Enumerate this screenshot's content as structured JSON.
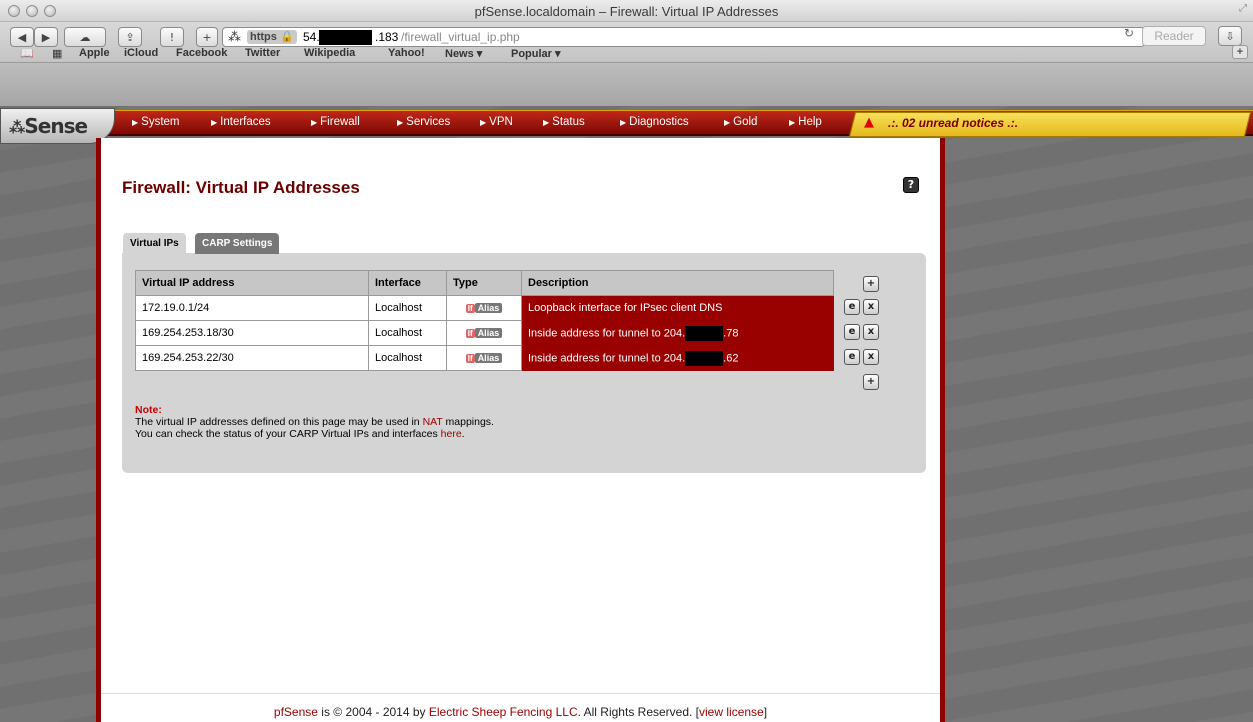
{
  "window": {
    "title": "pfSense.localdomain – Firewall: Virtual IP Addresses"
  },
  "address": {
    "https": "https",
    "host_prefix": "54.",
    "host_suffix": ".183",
    "path": "/firewall_virtual_ip.php",
    "reader": "Reader"
  },
  "bookmarks": [
    "Apple",
    "iCloud",
    "Facebook",
    "Twitter",
    "Wikipedia",
    "Yahoo!",
    "News ▾",
    "Popular ▾"
  ],
  "logo": "Sense",
  "nav": [
    "System",
    "Interfaces",
    "Firewall",
    "Services",
    "VPN",
    "Status",
    "Diagnostics",
    "Gold",
    "Help"
  ],
  "notice": ".:. 02 unread notices .:.",
  "page_title": "Firewall: Virtual IP Addresses",
  "help_label": "?",
  "tabs": [
    "Virtual IPs",
    "CARP Settings"
  ],
  "table": {
    "headers": [
      "Virtual IP address",
      "Interface",
      "Type",
      "Description"
    ],
    "rows": [
      {
        "ip": "172.19.0.1/24",
        "interface": "Localhost",
        "type_if": "If",
        "type_alias": "Alias",
        "desc_a": "Loopback interface for IPsec client DNS",
        "desc_b": ""
      },
      {
        "ip": "169.254.253.18/30",
        "interface": "Localhost",
        "type_if": "If",
        "type_alias": "Alias",
        "desc_a": "Inside address for tunnel to 204.",
        "desc_b": ".78"
      },
      {
        "ip": "169.254.253.22/30",
        "interface": "Localhost",
        "type_if": "If",
        "type_alias": "Alias",
        "desc_a": "Inside address for tunnel to 204.",
        "desc_b": ".62"
      }
    ]
  },
  "note": {
    "title": "Note:",
    "line1_a": "The virtual IP addresses defined on this page may be used in ",
    "line1_link": "NAT",
    "line1_b": " mappings.",
    "line2_a": "You can check the status of your CARP Virtual IPs and interfaces ",
    "line2_link": "here",
    "line2_b": "."
  },
  "footer": {
    "a": "pfSense",
    "b": " is © 2004 - 2014 by ",
    "c": "Electric Sheep Fencing LLC",
    "d": ". All Rights Reserved. [",
    "e": "view license",
    "f": "]"
  }
}
